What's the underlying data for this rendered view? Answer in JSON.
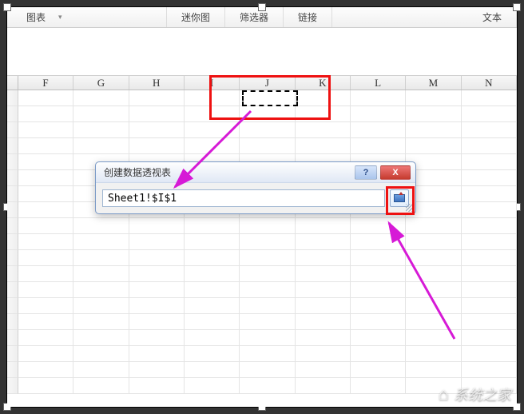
{
  "ribbon": {
    "charts": "图表",
    "sparklines": "迷你图",
    "filter": "筛选器",
    "links": "链接",
    "text": "文本"
  },
  "columns": [
    "F",
    "G",
    "H",
    "I",
    "J",
    "K",
    "L",
    "M",
    "N"
  ],
  "dialog": {
    "title": "创建数据透视表",
    "help_symbol": "?",
    "close_symbol": "X",
    "input_value": "Sheet1!$I$1"
  },
  "watermark": "系统之家"
}
